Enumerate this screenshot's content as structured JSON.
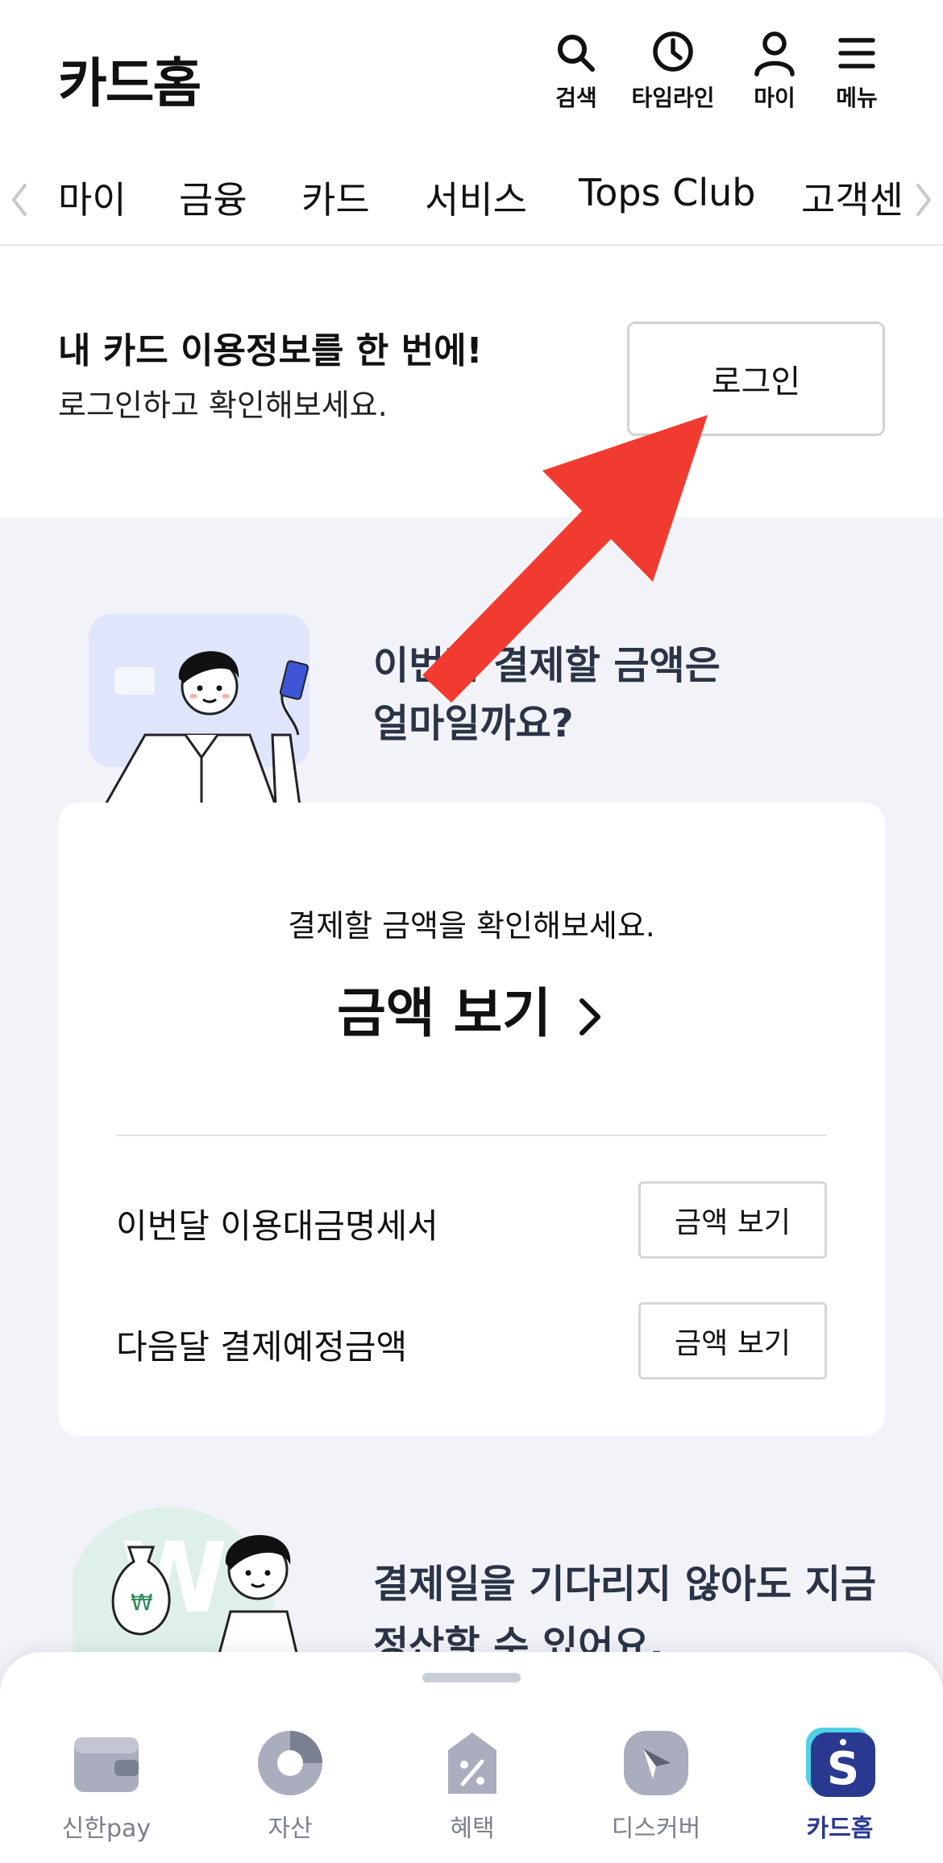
{
  "header": {
    "title": "카드홈",
    "actions": [
      {
        "label": "검색",
        "icon": "search-icon"
      },
      {
        "label": "타임라인",
        "icon": "clock-icon"
      },
      {
        "label": "마이",
        "icon": "user-icon"
      },
      {
        "label": "메뉴",
        "icon": "menu-icon"
      }
    ]
  },
  "tabs": [
    "마이",
    "금융",
    "카드",
    "서비스",
    "Tops Club",
    "고객센"
  ],
  "login": {
    "headline": "내 카드 이용정보를 한 번에!",
    "subtext": "로그인하고 확인해보세요.",
    "button": "로그인"
  },
  "promo1": {
    "line1": "이번달 결제할 금액은",
    "line2": "얼마일까요?"
  },
  "payment_card": {
    "subtitle": "결제할 금액을 확인해보세요.",
    "main_link": "금액 보기",
    "rows": [
      {
        "label": "이번달 이용대금명세서",
        "button": "금액 보기"
      },
      {
        "label": "다음달 결제예정금액",
        "button": "금액 보기"
      }
    ]
  },
  "promo2": {
    "line1": "결제일을 기다리지 않아도 지금",
    "line2": "정산할 수 있어요."
  },
  "bottom_nav": {
    "items": [
      {
        "label": "신한pay",
        "icon": "wallet-icon",
        "active": false
      },
      {
        "label": "자산",
        "icon": "pie-chart-icon",
        "active": false
      },
      {
        "label": "혜택",
        "icon": "tag-icon",
        "active": false
      },
      {
        "label": "디스커버",
        "icon": "compass-icon",
        "active": false
      },
      {
        "label": "카드홈",
        "icon": "card-home-icon",
        "active": true
      }
    ]
  },
  "colors": {
    "accent": "#2a3990",
    "arrow": "#f23b30",
    "background": "#f1f3f8",
    "heading": "#2b3346"
  }
}
